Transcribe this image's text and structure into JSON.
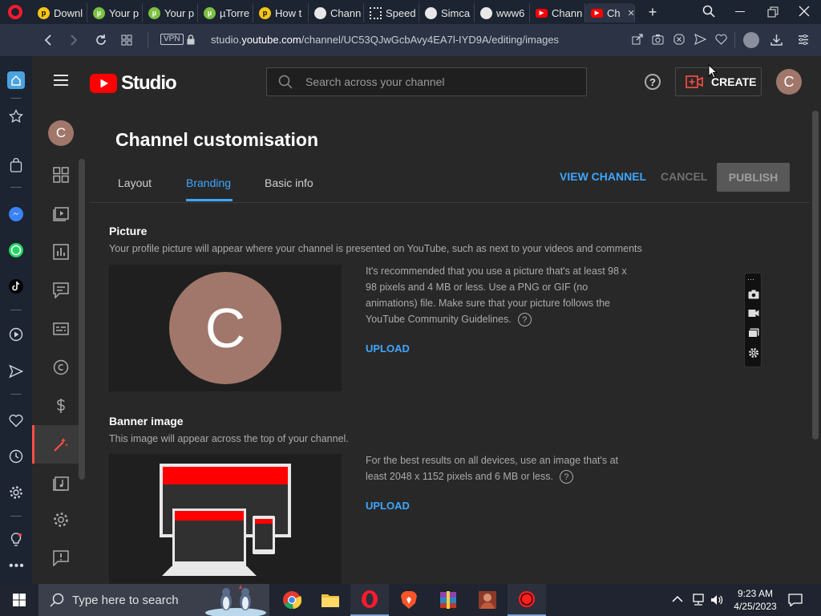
{
  "browser": {
    "tabs": [
      {
        "label": "Downl",
        "icon": "download-icon",
        "color": "#f5c518"
      },
      {
        "label": "Your p",
        "icon": "utorrent-icon",
        "color": "#7cc142"
      },
      {
        "label": "Your p",
        "icon": "utorrent-icon",
        "color": "#7cc142"
      },
      {
        "label": "µTorre",
        "icon": "utorrent-icon",
        "color": "#7cc142"
      },
      {
        "label": "How t",
        "icon": "download-icon",
        "color": "#f5c518"
      },
      {
        "label": "Chann",
        "icon": "globe-icon",
        "color": "#e8e8e8"
      },
      {
        "label": "Speed",
        "icon": "grid-icon",
        "color": "#e8e8e8"
      },
      {
        "label": "Simca",
        "icon": "globe-icon",
        "color": "#e8e8e8"
      },
      {
        "label": "www6",
        "icon": "globe-icon",
        "color": "#e8e8e8"
      },
      {
        "label": "Chann",
        "icon": "youtube-icon",
        "color": "#ff0000"
      },
      {
        "label": "Ch",
        "icon": "youtube-icon",
        "color": "#ff0000",
        "active": true
      }
    ],
    "url_prefix": "studio.",
    "url_domain": "youtube.com",
    "url_path": "/channel/UC53QJwGcbAvy4EA7l-IYD9A/editing/images",
    "vpn_label": "VPN",
    "accent": "#ff1b2d"
  },
  "header": {
    "logo_text": "Studio",
    "search_placeholder": "Search across your channel",
    "create_label": "CREATE",
    "avatar_letter": "C",
    "avatar_color": "#a0776a"
  },
  "nav": {
    "avatar_letter": "C",
    "items": [
      "dashboard",
      "content",
      "analytics",
      "comments",
      "subtitles",
      "copyright",
      "earn",
      "customisation",
      "audio-library",
      "settings",
      "feedback"
    ]
  },
  "main": {
    "title": "Channel customisation",
    "tabs": [
      "Layout",
      "Branding",
      "Basic info"
    ],
    "active_tab": "Branding",
    "view_channel": "VIEW CHANNEL",
    "cancel": "CANCEL",
    "publish": "PUBLISH",
    "picture": {
      "title": "Picture",
      "desc": "Your profile picture will appear where your channel is presented on YouTube, such as next to your videos and comments",
      "avatar_letter": "C",
      "info": "It's recommended that you use a picture that's at least 98 x 98 pixels and 4 MB or less. Use a PNG or GIF (no animations) file. Make sure that your picture follows the YouTube Community Guidelines.",
      "upload": "UPLOAD"
    },
    "banner": {
      "title": "Banner image",
      "desc": "This image will appear across the top of your channel.",
      "info": "For the best results on all devices, use an image that's at least 2048 x 1152 pixels and 6 MB or less.",
      "upload": "UPLOAD"
    },
    "help_glyph": "?"
  },
  "taskbar": {
    "search_placeholder": "Type here to search",
    "time": "9:23 AM",
    "date": "4/25/2023"
  }
}
